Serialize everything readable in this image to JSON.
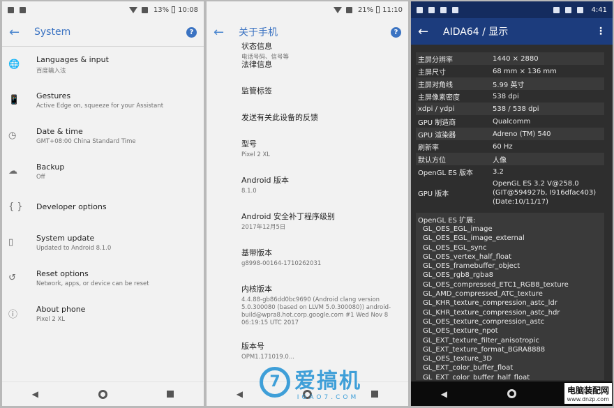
{
  "panel1": {
    "status": {
      "battery": "13%",
      "time": "10:08"
    },
    "title": "System",
    "items": [
      {
        "icon": "globe-icon",
        "glyph": "🌐",
        "title": "Languages & input",
        "sub": "百度输入法"
      },
      {
        "icon": "gestures-icon",
        "glyph": "📱",
        "title": "Gestures",
        "sub": "Active Edge on, squeeze for your Assistant"
      },
      {
        "icon": "clock-icon",
        "glyph": "◷",
        "title": "Date & time",
        "sub": "GMT+08:00 China Standard Time"
      },
      {
        "icon": "cloud-upload-icon",
        "glyph": "☁",
        "title": "Backup",
        "sub": "Off"
      },
      {
        "icon": "braces-icon",
        "glyph": "{ }",
        "title": "Developer options",
        "sub": ""
      },
      {
        "icon": "system-update-icon",
        "glyph": "▯",
        "title": "System update",
        "sub": "Updated to Android 8.1.0"
      },
      {
        "icon": "restore-icon",
        "glyph": "↺",
        "title": "Reset options",
        "sub": "Network, apps, or device can be reset"
      },
      {
        "icon": "info-icon",
        "glyph": "ⓘ",
        "title": "About phone",
        "sub": "Pixel 2 XL"
      }
    ]
  },
  "panel2": {
    "status": {
      "battery": "21%",
      "time": "11:10"
    },
    "title": "关于手机",
    "items": [
      {
        "title": "状态信息",
        "sub": "电话号码、信号等"
      },
      {
        "title": "法律信息",
        "sub": ""
      },
      {
        "title": "监管标签",
        "sub": ""
      },
      {
        "title": "发送有关此设备的反馈",
        "sub": ""
      },
      {
        "title": "型号",
        "sub": "Pixel 2 XL"
      },
      {
        "title": "Android 版本",
        "sub": "8.1.0"
      },
      {
        "title": "Android 安全补丁程序级别",
        "sub": "2017年12月5日"
      },
      {
        "title": "基带版本",
        "sub": "g8998-00164-1710262031"
      },
      {
        "title": "内核版本",
        "sub": "4.4.88-gb86dd0bc9690 (Android clang version 5.0.300080 (based on LLVM 5.0.300080)) android-build@wpra8.hot.corp.google.com #1 Wed Nov 8 06:19:15 UTC 2017"
      },
      {
        "title": "版本号",
        "sub": "OPM1.171019.0..."
      }
    ]
  },
  "panel3": {
    "status": {
      "time": "4:41"
    },
    "title": "AIDA64 / 显示",
    "rows": [
      {
        "k": "主屏分辨率",
        "v": "1440 × 2880"
      },
      {
        "k": "主屏尺寸",
        "v": "68 mm × 136 mm"
      },
      {
        "k": "主屏对角线",
        "v": "5.99 英寸"
      },
      {
        "k": "主屏像素密度",
        "v": "538 dpi"
      },
      {
        "k": "xdpi / ydpi",
        "v": "538 / 538 dpi"
      },
      {
        "k": "GPU 制造商",
        "v": "Qualcomm"
      },
      {
        "k": "GPU 渲染器",
        "v": "Adreno (TM) 540"
      },
      {
        "k": "刷新率",
        "v": "60 Hz"
      },
      {
        "k": "默认方位",
        "v": "人像"
      },
      {
        "k": "OpenGL ES 版本",
        "v": "3.2"
      }
    ],
    "gpu_version": {
      "k": "GPU 版本",
      "v": "OpenGL ES 3.2 V@258.0 (GIT@594927b, I916dfac403) (Date:10/11/17)"
    },
    "ext_header": "OpenGL ES 扩展:",
    "extensions": [
      "GL_OES_EGL_image",
      "GL_OES_EGL_image_external",
      "GL_OES_EGL_sync",
      "GL_OES_vertex_half_float",
      "GL_OES_framebuffer_object",
      "GL_OES_rgb8_rgba8",
      "GL_OES_compressed_ETC1_RGB8_texture",
      "GL_AMD_compressed_ATC_texture",
      "GL_KHR_texture_compression_astc_ldr",
      "GL_KHR_texture_compression_astc_hdr",
      "GL_OES_texture_compression_astc",
      "GL_OES_texture_npot",
      "GL_EXT_texture_filter_anisotropic",
      "GL_EXT_texture_format_BGRA8888",
      "GL_OES_texture_3D",
      "GL_EXT_color_buffer_float",
      "GL_EXT_color_buffer_half_float"
    ]
  },
  "watermark": {
    "brand": "爱搞机",
    "site": "IGAO7.COM"
  },
  "corner": {
    "name": "电脑装配网",
    "url": "www.dnzp.com"
  }
}
